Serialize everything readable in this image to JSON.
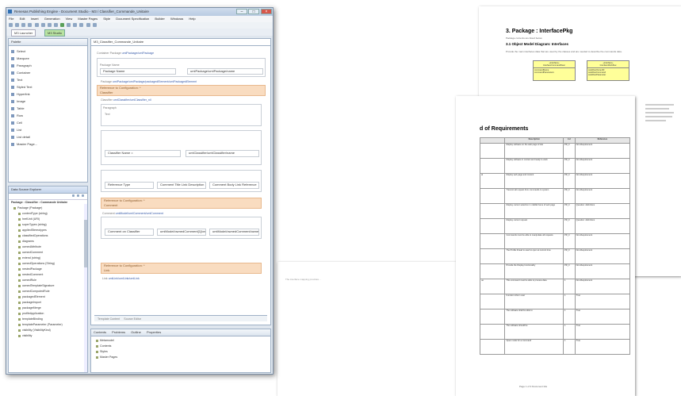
{
  "window": {
    "title": "Renesas Publishing Engine - Document Studio - M3 / Classifier_Commande_Unitaire",
    "controls": [
      "–",
      "□",
      "×"
    ],
    "menu": [
      "File",
      "Edit",
      "Insert",
      "Generation",
      "View",
      "Master Pages",
      "Style",
      "Document Specification",
      "Builder",
      "Windows",
      "Help"
    ],
    "perspectives": [
      "M3 Launcher",
      "M3 Studio"
    ]
  },
  "left_panel": {
    "tab": "Palette",
    "items": [
      "Select",
      "Marquee",
      "Paragraph",
      "Container",
      "Text",
      "Styled Text",
      "Hyperlink",
      "Image",
      "Table",
      "Row",
      "Cell",
      "List",
      "List detail",
      "Master Page..."
    ]
  },
  "model_panel": {
    "tab": "Data Source Explorer",
    "header": "Package : Classifier : Commande Unitaire",
    "items": [
      "Package (Package)",
      "contentType (string)",
      "hrefUnit (URI)",
      "superTypes (string)",
      "appliedStereotypes",
      "classifiedOperations",
      "diagrams",
      "ownedAttribute",
      "ownedComment",
      "extend (string)",
      "ownedOperations (String)",
      "nestedPackage",
      "nestedComment",
      "ownedRule",
      "ownedTemplateSignature",
      "ownedComputedRule",
      "packagedElement",
      "packageImport",
      "packageMerge",
      "profileApplication",
      "templateBinding",
      "templateParameter (Parameter)",
      "visibility (VisibilityKind)",
      "visibility"
    ]
  },
  "editor": {
    "tab": "M3_Classifier_Commande_Unitaire",
    "breadcrumb_label": "Container",
    "breadcrumb_type": "Package",
    "breadcrumb_link": "umlPackage/umlPackage",
    "package_label": "Package Name",
    "package_value": "umlPackage/umlPackage/name",
    "sub_breadcrumb_link": "umlPackage/umlPackage/packagedElement/umlPackagedElement",
    "section1_title": "Reference to Configuration: *",
    "section1_value": "Classifier",
    "classifier_link": "umlClassifier/umlClassifier_nil",
    "paragraph_label": "Paragraph",
    "text_label": "Text",
    "classifier_name": "Classifier Name =",
    "classifier_name_path": "umlClassifier/umlClassifier/name",
    "row_headers": [
      "Reference Type",
      "Comment Title Link Description",
      "Comment Body Link Reference"
    ],
    "section2_title": "Reference to Configuration: *",
    "section2_value": "Comment",
    "comment_link": "umlModel/umlComment/umlComment",
    "comment_cell": "Comment on Classifier",
    "comment_path": "umlModel/ownedComment[1]/ownedComment/body",
    "comment_path2": "umlModel/ownedComment/ownedComment/body",
    "section3_title": "Reference to Configuration: *",
    "section3_value": "Link",
    "link_path": "umlLink/umlLink/umlLink",
    "bottom_tabs": [
      "Template Content",
      "Source Editor"
    ]
  },
  "bottom_panel": {
    "tabs": [
      "Contents",
      "Problems",
      "Outline",
      "Properties"
    ],
    "items": [
      "Metamodel",
      "Contents",
      "Styles",
      "Master Pages"
    ]
  },
  "doc1": {
    "heading": "3.  Package : InterfacePkg",
    "intro": "Package contents are listed below.",
    "subheading": "3.1  Object Model Diagram: Interfaces",
    "para": "Provide the main interfaces data that are used by the classes and are needed to describe the commands data.",
    "boxes": [
      {
        "title": "«interface»\nInterfaceCommandDesc",
        "attrs": "commandName\ncommandParameters"
      },
      {
        "title": "«interface»\nInterfaceWorkflow",
        "attrs": "workflowOwnerID\nworkflowCommand\nworkflowParameter"
      }
    ]
  },
  "doc2": {
    "heading": "d of Requirements",
    "columns": [
      "",
      "Description",
      "Lvl",
      "Reference"
    ],
    "rows": [
      [
        "",
        "Display software on the web page of site",
        "PR_0",
        "Non-Requirement"
      ],
      [
        "",
        "Display software in context and ready to work",
        "PR_0",
        "Non-Requirement"
      ],
      [
        "al",
        "Display web page and content",
        "PR_0",
        "Non-Requirement"
      ],
      [
        "",
        "Transmit all request from commands to system",
        "PR_0",
        "Non-Requirement"
      ],
      [
        "",
        "Display current selection in middle frame of web page",
        "PR_0",
        "Question: definitions"
      ],
      [
        "",
        "Display current request",
        "PR_0",
        "Question: definitions"
      ],
      [
        "",
        "Commands must be able to manipulate all requests",
        "PR_0",
        "Non-Requirement"
      ],
      [
        "",
        "The Profile thread is used to open at current time",
        "PR_0",
        "Non-Requirement"
      ],
      [
        "",
        "Provide the Display functionality",
        "PR_0",
        "Non-Requirement"
      ],
      [
        "ue",
        "This command must be able to process data",
        "1",
        "Non-Requirement"
      ],
      [
        "",
        "Function inform user",
        "1",
        "True"
      ],
      [
        "",
        "The software shall be able to",
        "1",
        "True"
      ],
      [
        "",
        "The software should be",
        "1",
        "True"
      ],
      [
        "",
        "Open mode for a command",
        "1",
        "True"
      ]
    ],
    "footer": "Page 1 of 3    Document title"
  },
  "doc3": {
    "lines": [
      "The interface mapping provides..."
    ]
  }
}
